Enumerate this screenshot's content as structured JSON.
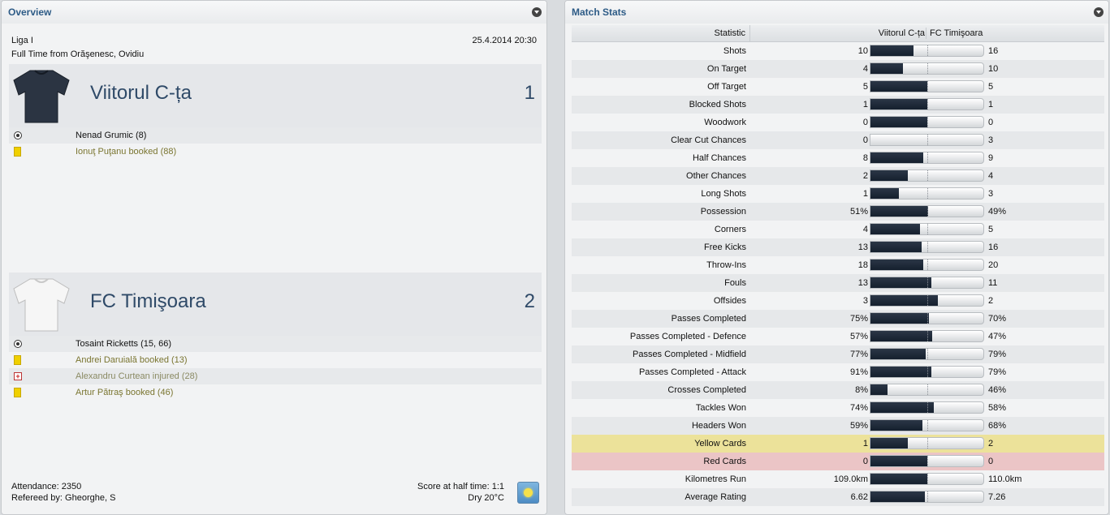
{
  "overview": {
    "title": "Overview",
    "competition": "Liga I",
    "datetime": "25.4.2014 20:30",
    "status": "Full Time from Orăşenesc, Ovidiu",
    "home": {
      "name": "Viitorul C-ța",
      "score": "1",
      "shirt_color": "#2b3442",
      "events": [
        {
          "type": "goal",
          "icon": "ball-icon",
          "text": "Nenad Grumic (8)"
        },
        {
          "type": "booked",
          "icon": "yellow-card-icon",
          "text": "Ionuţ Puţanu booked (88)"
        }
      ]
    },
    "away": {
      "name": "FC Timişoara",
      "score": "2",
      "shirt_color": "#f4f4f4",
      "events": [
        {
          "type": "goal",
          "icon": "ball-icon",
          "text": "Tosaint Ricketts (15, 66)"
        },
        {
          "type": "booked",
          "icon": "yellow-card-icon",
          "text": "Andrei Daruială booked (13)"
        },
        {
          "type": "injury",
          "icon": "injury-icon",
          "text": "Alexandru Curtean injured (28)"
        },
        {
          "type": "booked",
          "icon": "yellow-card-icon",
          "text": "Artur Pătraş booked (46)"
        }
      ]
    },
    "attendance": "Attendance: 2350",
    "referee": "Refereed by: Gheorghe, S",
    "half_time": "Score at half time: 1:1",
    "weather": "Dry 20°C",
    "weather_icon": "sun-icon"
  },
  "match_stats": {
    "title": "Match Stats",
    "header": {
      "statistic": "Statistic",
      "home": "Viitorul C-ța",
      "away": "FC Timişoara"
    },
    "rows": [
      {
        "label": "Shots",
        "home": "10",
        "away": "16",
        "home_share": 0.38
      },
      {
        "label": "On Target",
        "home": "4",
        "away": "10",
        "home_share": 0.29
      },
      {
        "label": "Off Target",
        "home": "5",
        "away": "5",
        "home_share": 0.5
      },
      {
        "label": "Blocked Shots",
        "home": "1",
        "away": "1",
        "home_share": 0.5
      },
      {
        "label": "Woodwork",
        "home": "0",
        "away": "0",
        "home_share": 0.5
      },
      {
        "label": "Clear Cut Chances",
        "home": "0",
        "away": "3",
        "home_share": 0
      },
      {
        "label": "Half Chances",
        "home": "8",
        "away": "9",
        "home_share": 0.47
      },
      {
        "label": "Other Chances",
        "home": "2",
        "away": "4",
        "home_share": 0.33
      },
      {
        "label": "Long Shots",
        "home": "1",
        "away": "3",
        "home_share": 0.25
      },
      {
        "label": "Possession",
        "home": "51%",
        "away": "49%",
        "home_share": 0.51
      },
      {
        "label": "Corners",
        "home": "4",
        "away": "5",
        "home_share": 0.44
      },
      {
        "label": "Free Kicks",
        "home": "13",
        "away": "16",
        "home_share": 0.45
      },
      {
        "label": "Throw-Ins",
        "home": "18",
        "away": "20",
        "home_share": 0.47
      },
      {
        "label": "Fouls",
        "home": "13",
        "away": "11",
        "home_share": 0.54
      },
      {
        "label": "Offsides",
        "home": "3",
        "away": "2",
        "home_share": 0.6
      },
      {
        "label": "Passes Completed",
        "home": "75%",
        "away": "70%",
        "home_share": 0.52
      },
      {
        "label": "Passes Completed - Defence",
        "home": "57%",
        "away": "47%",
        "home_share": 0.55
      },
      {
        "label": "Passes Completed - Midfield",
        "home": "77%",
        "away": "79%",
        "home_share": 0.49
      },
      {
        "label": "Passes Completed - Attack",
        "home": "91%",
        "away": "79%",
        "home_share": 0.54
      },
      {
        "label": "Crosses Completed",
        "home": "8%",
        "away": "46%",
        "home_share": 0.15
      },
      {
        "label": "Tackles Won",
        "home": "74%",
        "away": "58%",
        "home_share": 0.56
      },
      {
        "label": "Headers Won",
        "home": "59%",
        "away": "68%",
        "home_share": 0.46
      },
      {
        "label": "Yellow Cards",
        "home": "1",
        "away": "2",
        "home_share": 0.33,
        "highlight": "yellow"
      },
      {
        "label": "Red Cards",
        "home": "0",
        "away": "0",
        "home_share": 0.5,
        "highlight": "red"
      },
      {
        "label": "Kilometres Run",
        "home": "109.0km",
        "away": "110.0km",
        "home_share": 0.5
      },
      {
        "label": "Average Rating",
        "home": "6.62",
        "away": "7.26",
        "home_share": 0.48
      }
    ]
  },
  "colors": {
    "title": "#2d5b86",
    "team_name": "#2f4a68",
    "bar": "#1c2736",
    "booked_text": "#7a7530"
  }
}
